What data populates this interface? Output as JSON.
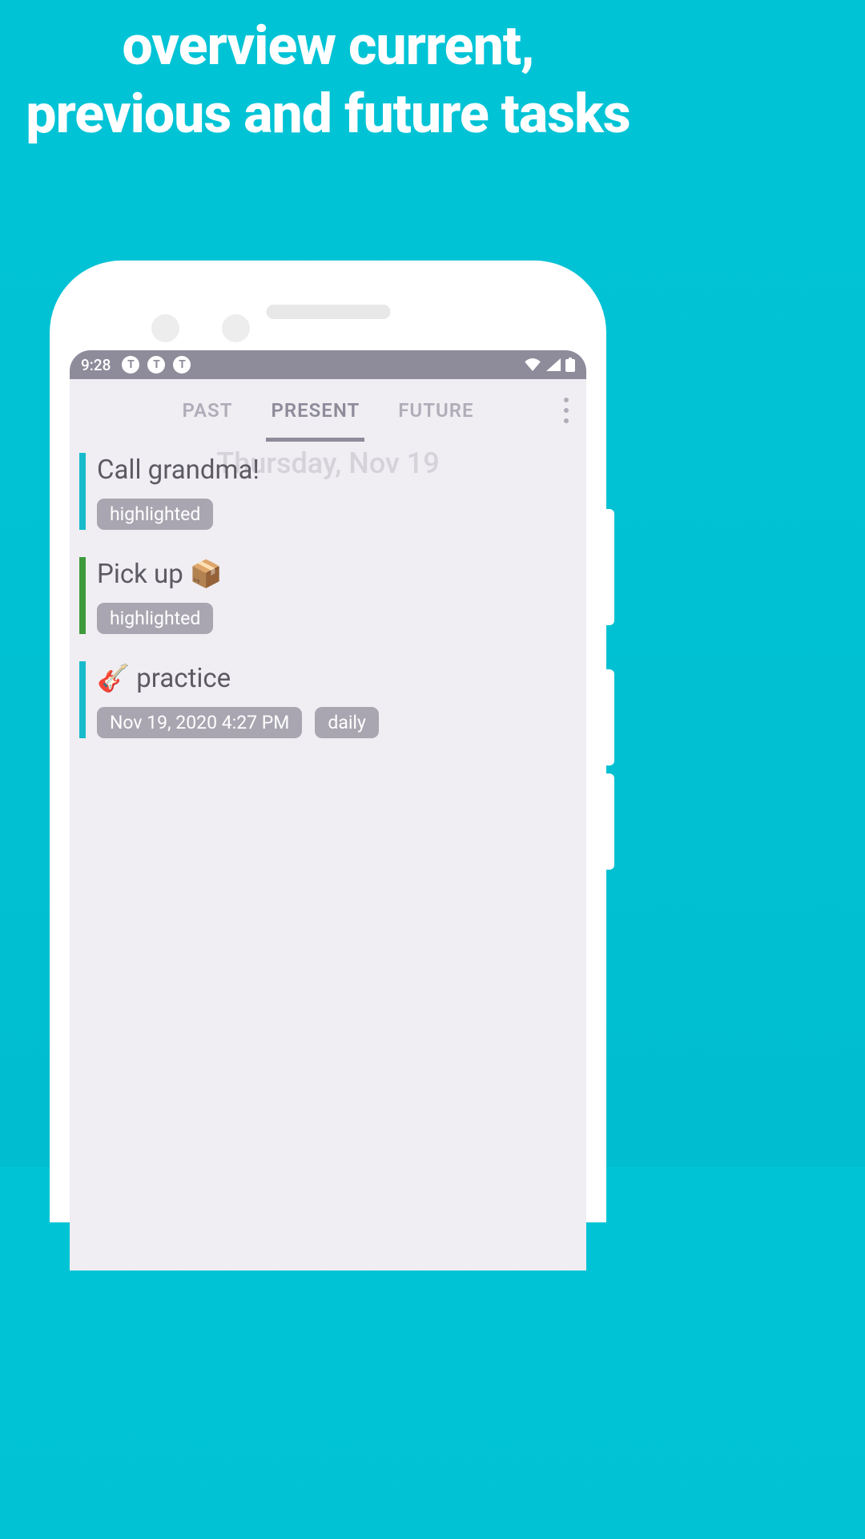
{
  "promo": {
    "title": "overview current, previous and future tasks"
  },
  "status": {
    "time": "9:28",
    "notif_letter": "T"
  },
  "tabs": {
    "items": [
      {
        "label": "PAST",
        "active": false
      },
      {
        "label": "PRESENT",
        "active": true
      },
      {
        "label": "FUTURE",
        "active": false
      }
    ]
  },
  "date_header": "Thursday, Nov 19",
  "tasks": [
    {
      "title": "Call grandma!",
      "bar_color": "#17BBCB",
      "chips": [
        "highlighted"
      ]
    },
    {
      "title": "Pick up 📦",
      "bar_color": "#3E9A3B",
      "chips": [
        "highlighted"
      ]
    },
    {
      "title": "🎸 practice",
      "bar_color": "#17BBCB",
      "chips": [
        "Nov 19, 2020 4:27 PM",
        "daily"
      ]
    }
  ]
}
